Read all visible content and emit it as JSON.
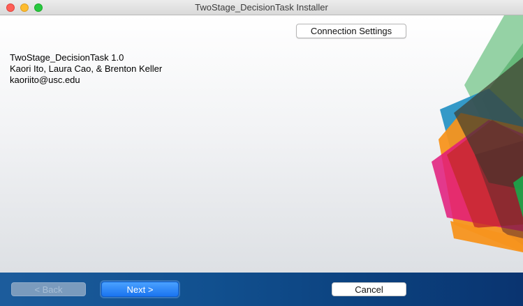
{
  "window": {
    "title": "TwoStage_DecisionTask Installer"
  },
  "content": {
    "connection_button_label": "Connection Settings",
    "info_lines": [
      "TwoStage_DecisionTask 1.0",
      "Kaori Ito, Laura Cao, & Brenton Keller",
      "kaoriito@usc.edu"
    ]
  },
  "footer": {
    "back_label": "< Back",
    "next_label": "Next >",
    "cancel_label": "Cancel"
  },
  "colors": {
    "accent_blue": "#1a74f0",
    "footer_blue": "#11508f",
    "shape_green": "#7fc890",
    "shape_teal": "#1f8fc2",
    "shape_orange": "#f7941d",
    "shape_magenta": "#e2197a",
    "shape_red": "#d22a2f",
    "shape_dark": "#4a2f2f"
  }
}
